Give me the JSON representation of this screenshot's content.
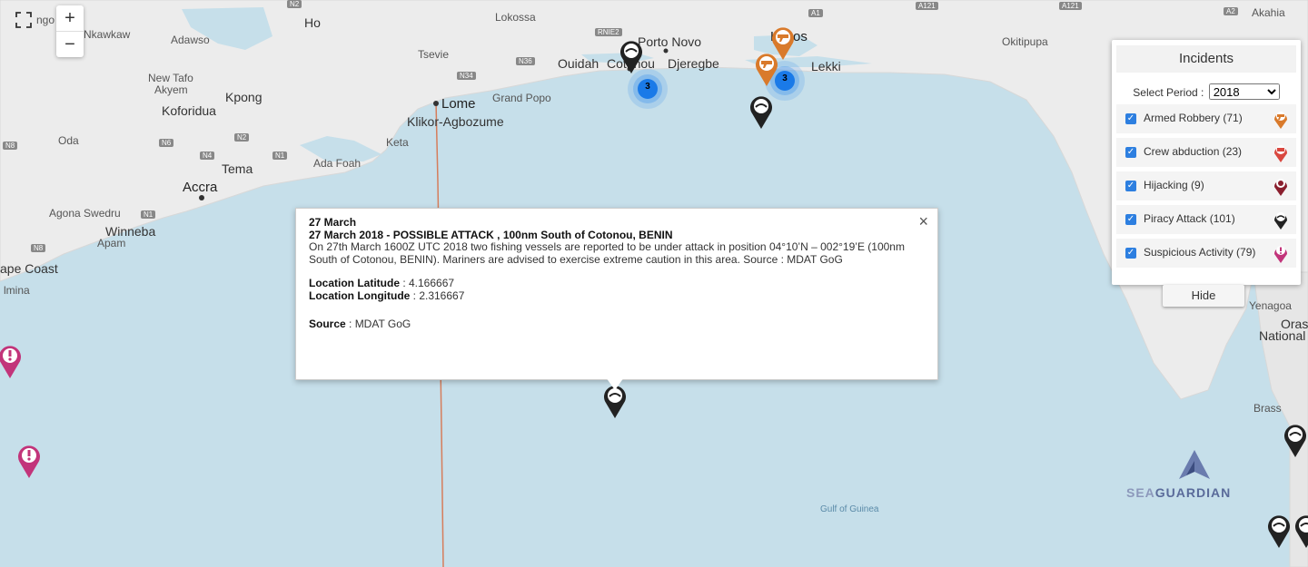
{
  "map": {
    "zoom_in": "+",
    "zoom_out": "−",
    "labels": {
      "ngo": "ngo",
      "ho": "Ho",
      "lokossa": "Lokossa",
      "nkawkaw": "Nkawkaw",
      "adawso": "Adawso",
      "tsevie": "Tsevie",
      "porto_novo": "Porto Novo",
      "ouidah": "Ouidah",
      "cotonou": "Cotonou",
      "djeregbe": "Djeregbe",
      "lagos": "Lagos",
      "lekki": "Lekki",
      "okitipupa": "Okitipupa",
      "akahia": "Akahia",
      "grand_popo": "Grand Popo",
      "lome": "Lome",
      "klikor": "Klikor-Agbozume",
      "new_tafo": "New Tafo",
      "akyem": "Akyem",
      "kpong": "Kpong",
      "koforidua": "Koforidua",
      "oda": "Oda",
      "keta": "Keta",
      "tema": "Tema",
      "ada_foah": "Ada Foah",
      "accra": "Accra",
      "agona_swedru": "Agona Swedru",
      "winneba": "Winneba",
      "apam": "Apam",
      "cape_coast": "ape Coast",
      "elmina": "lmina",
      "yenagoa": "Yenagoa",
      "oras": "Oras",
      "national": "National",
      "brass": "Brass",
      "gulf_of_guinea": "Gulf of Guinea"
    },
    "roads": [
      "N2",
      "RNIE2",
      "N34",
      "N36",
      "N6",
      "N2",
      "N4",
      "N1",
      "N8",
      "N1",
      "N8",
      "A1",
      "A121",
      "A121",
      "A2",
      "N8"
    ],
    "clusters": [
      {
        "count": "3"
      },
      {
        "count": "3"
      }
    ]
  },
  "popup": {
    "date": "27 March",
    "headline": "27 March 2018 - POSSIBLE ATTACK , 100nm South of Cotonou, BENIN",
    "body": "On 27th March 1600Z UTC 2018 two fishing vessels are reported to be under attack in position 04°10’N – 002°19’E (100nm South of Cotonou, BENIN). Mariners are advised to exercise extreme caution in this area. Source : MDAT GoG",
    "lat_label": "Location Latitude",
    "lat_value": " : 4.166667",
    "lon_label": "Location Longitude",
    "lon_value": " : 2.316667",
    "source_label": "Source",
    "source_value": " : MDAT GoG",
    "close": "×"
  },
  "panel": {
    "title": "Incidents",
    "period_label": "Select Period :",
    "period_value": "2018",
    "items": [
      {
        "label": "Armed Robbery (71)",
        "color": "#d97a2b"
      },
      {
        "label": "Crew abduction (23)",
        "color": "#d9473f"
      },
      {
        "label": "Hijacking (9)",
        "color": "#8a1f2e"
      },
      {
        "label": "Piracy Attack (101)",
        "color": "#222222"
      },
      {
        "label": "Suspicious Activity (79)",
        "color": "#c2347a"
      }
    ],
    "hide": "Hide"
  },
  "brand": {
    "part1": "SEA",
    "part2": "GUARDIAN"
  }
}
